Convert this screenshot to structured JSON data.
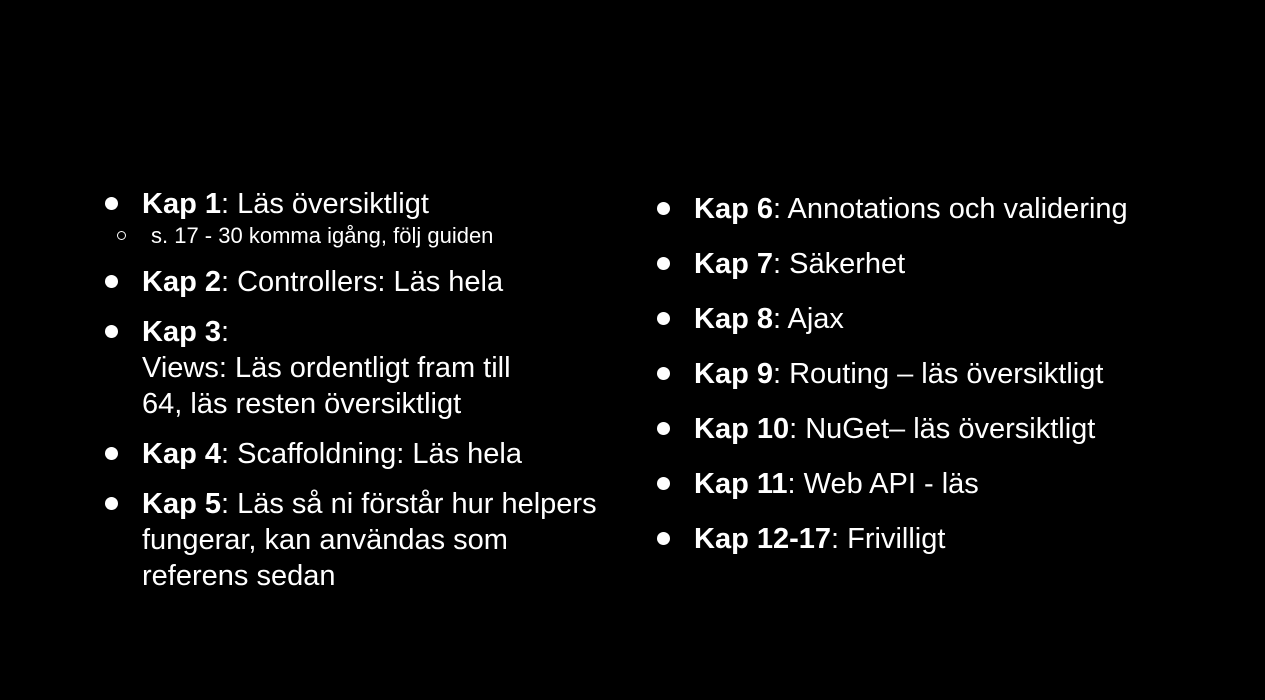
{
  "left_column": {
    "items": [
      {
        "kap": "Kap 1",
        "sep": ": ",
        "text": "Läs översiktligt",
        "sub": "s. 17 - 30 komma igång, följ guiden"
      },
      {
        "kap": "Kap 2",
        "sep": ": ",
        "text": "Controllers: Läs hela"
      },
      {
        "kap": "Kap 3",
        "sep": ":",
        "line2": "Views: Läs ordentligt fram till",
        "line3": "64, läs resten översiktligt"
      },
      {
        "kap": "Kap 4",
        "sep": ": ",
        "text": "Scaffoldning: Läs hela"
      },
      {
        "kap": "Kap 5",
        "sep": ": ",
        "text": "Läs så ni förstår hur helpers",
        "line2": "fungerar, kan användas som",
        "line3": "referens sedan"
      }
    ]
  },
  "right_column": {
    "items": [
      {
        "kap": "Kap 6",
        "sep": ": ",
        "text": "Annotations och validering"
      },
      {
        "kap": "Kap 7",
        "sep": ": ",
        "text": "Säkerhet"
      },
      {
        "kap": "Kap 8",
        "sep": ": ",
        "text": "Ajax"
      },
      {
        "kap": "Kap 9",
        "sep": ": ",
        "text": "Routing – läs översiktligt"
      },
      {
        "kap": "Kap 10",
        "sep": ": ",
        "text": "NuGet– läs översiktligt"
      },
      {
        "kap": "Kap 11",
        "sep": ": ",
        "text": "Web API - läs"
      },
      {
        "kap": "Kap 12-17",
        "sep": ": ",
        "text": "Frivilligt"
      }
    ]
  },
  "colors": {
    "background": "#000000",
    "text": "#ffffff"
  }
}
